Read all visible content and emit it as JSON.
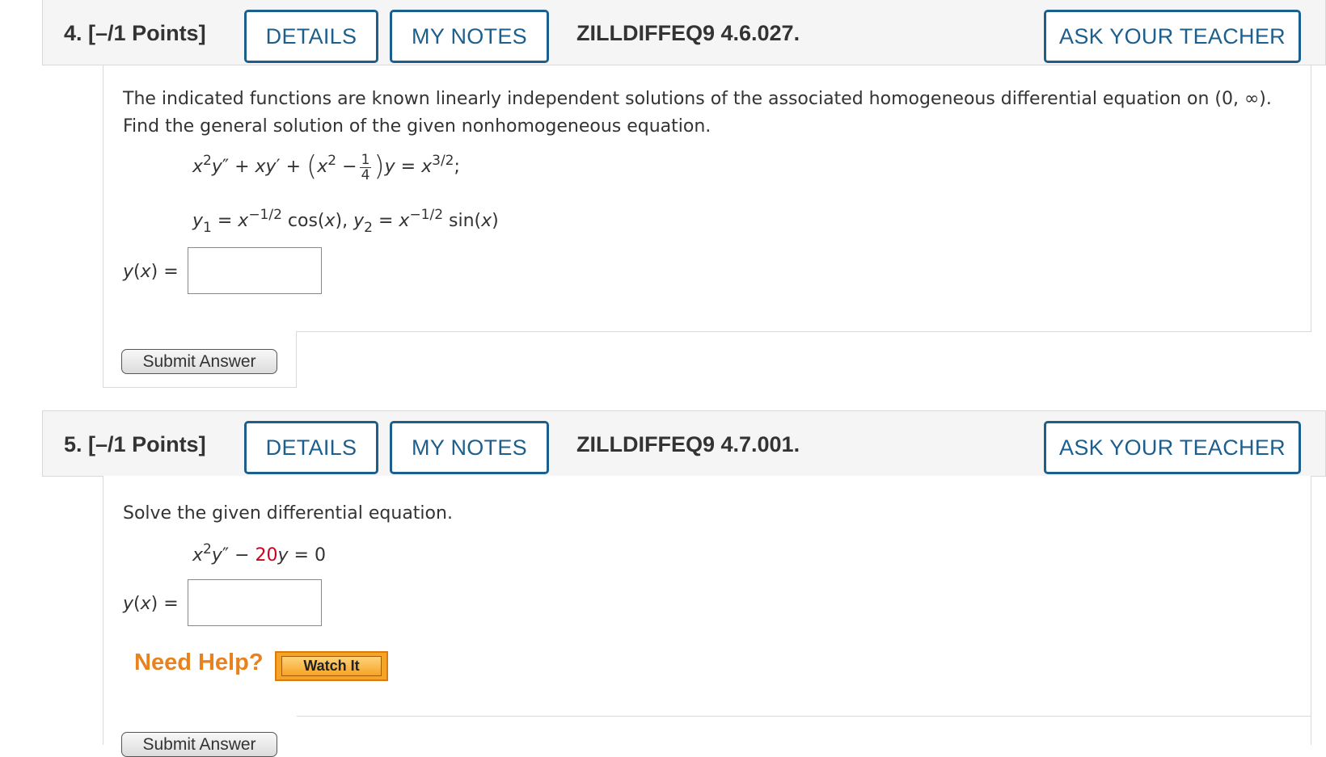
{
  "q4": {
    "number": "4.",
    "points": "[–/1 Points]",
    "details_label": "DETAILS",
    "notes_label": "MY NOTES",
    "code": "ZILLDIFFEQ9 4.6.027.",
    "ask_label": "ASK YOUR TEACHER",
    "prompt_line1": "The indicated functions are known linearly independent solutions of the associated homogeneous differential equation on (0, ∞).",
    "prompt_line2": "Find the general solution of the given nonhomogeneous equation.",
    "answer_label": "y(x) =",
    "answer_value": "",
    "submit_label": "Submit Answer"
  },
  "q5": {
    "number": "5.",
    "points": "[–/1 Points]",
    "details_label": "DETAILS",
    "notes_label": "MY NOTES",
    "code": "ZILLDIFFEQ9 4.7.001.",
    "ask_label": "ASK YOUR TEACHER",
    "prompt": "Solve the given differential equation.",
    "coefficient": "20",
    "answer_label": "y(x) =",
    "answer_value": "",
    "need_help": "Need Help?",
    "watch_label": "Watch It",
    "submit_label": "Submit Answer"
  },
  "colors": {
    "button_blue": "#1d5f8c",
    "highlight_red": "#d0021b",
    "help_orange": "#e8821e"
  }
}
